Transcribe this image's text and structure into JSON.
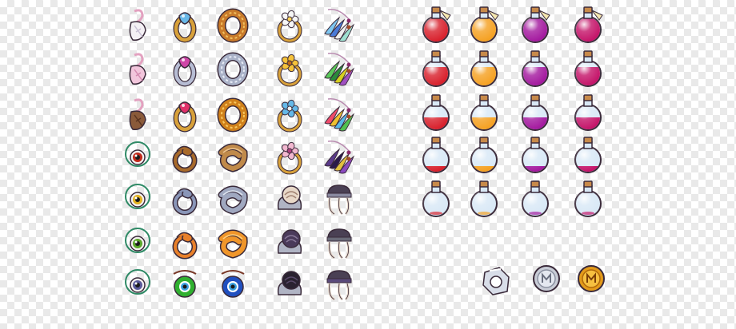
{
  "sheet": {
    "background": "transparency-checkerboard",
    "sections": [
      {
        "name": "accessories",
        "columns": [
          "charm",
          "ring",
          "band",
          "medallion",
          "feather-pendant"
        ],
        "rows": [
          [
            "white-feather-charm",
            "blue-gem-gold-ring",
            "gold-band",
            "white-flower-medallion",
            "blue-feather-pendant"
          ],
          [
            "pink-feather-charm",
            "pink-heart-silver-ring",
            "silver-band",
            "gold-flower-medallion",
            "green-feather-pendant"
          ],
          [
            "brown-feather-charm",
            "pink-heart-gold-ring",
            "gold-ornate-band",
            "blue-flower-medallion",
            "multicolor-feather-pendant"
          ],
          [
            "red-eye-amulet",
            "bronze-twisted-ring",
            "bronze-coiled-band",
            "pink-flower-medallion",
            "purple-feather-pendant"
          ],
          [
            "yellow-eye-amulet",
            "silver-twisted-ring",
            "silver-coiled-band",
            "shell-brooch",
            "gray-hat-ornament"
          ],
          [
            "green-eye-amulet",
            "orange-twisted-ring",
            "orange-coiled-band",
            "dark-rose-brooch",
            "dark-hat-ornament"
          ],
          [
            "blue-eye-amulet",
            "green-evil-eye-charm",
            "blue-evil-eye-charm",
            "black-rose-brooch",
            "purple-hat-ornament"
          ]
        ]
      },
      {
        "name": "potions",
        "colors": [
          "#d81e2a",
          "#f5a020",
          "#a3179e",
          "#c41268"
        ],
        "fill_levels": [
          1.0,
          0.75,
          0.5,
          0.25,
          0.0
        ]
      },
      {
        "name": "currency",
        "items": [
          "silver-gem-ring",
          "silver-coin",
          "gold-coin"
        ]
      }
    ]
  }
}
